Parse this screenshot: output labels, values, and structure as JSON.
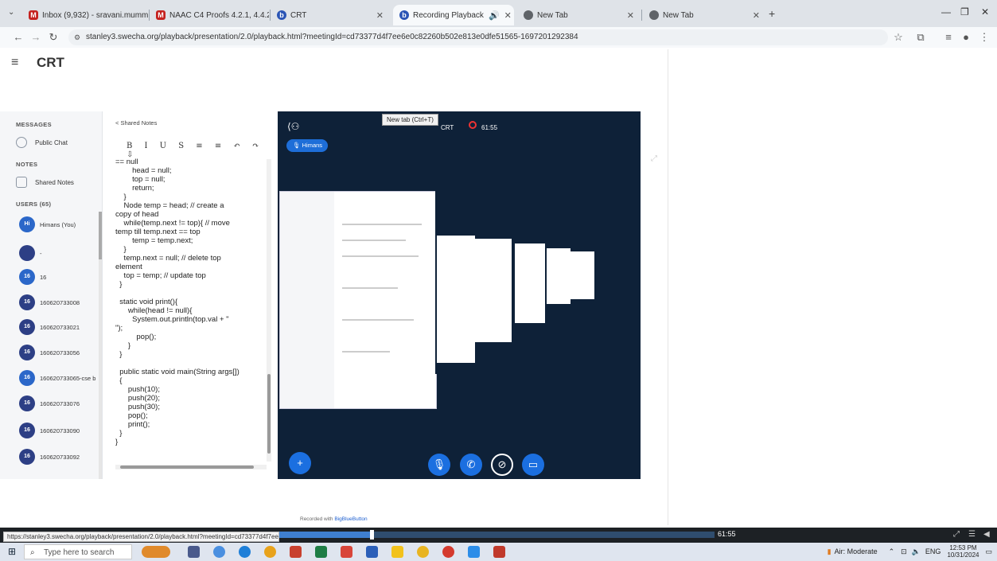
{
  "browser": {
    "tabs": [
      {
        "label": "Inbox (9,932) - sravani.mummo...",
        "icon": "gmail-icon",
        "color": "#c5221f"
      },
      {
        "label": "NAAC C4 Proofs 4.2.1, 4.4.2, 4.3...",
        "icon": "gmail-icon",
        "color": "#c5221f"
      },
      {
        "label": "CRT",
        "icon": "bbb-icon",
        "color": "#2b55b5"
      },
      {
        "label": "Recording Playback",
        "icon": "bbb-icon",
        "color": "#2b55b5"
      },
      {
        "label": "New Tab",
        "icon": "chrome-icon",
        "color": "#5f6368"
      },
      {
        "label": "New Tab",
        "icon": "chrome-icon",
        "color": "#5f6368"
      }
    ],
    "url": "stanley3.swecha.org/playback/presentation/2.0/playback.html?meetingId=cd73377d4f7ee6e0c82260b502e813e0dfe51565-1697201292384",
    "hover_url": "https://stanley3.swecha.org/playback/presentation/2.0/playback.html?meetingId=cd73377d4f7ee6e0c82260b502e81..."
  },
  "app": {
    "title": "CRT"
  },
  "tooltip": "New tab (Ctrl+T)",
  "sidebar": {
    "messages_heading": "MESSAGES",
    "public_chat": "Public Chat",
    "notes_heading": "NOTES",
    "shared_notes": "Shared Notes",
    "users_heading": "USERS (65)",
    "users": [
      {
        "initials": "Hi",
        "name": "Himans (You)"
      },
      {
        "initials": "",
        "name": "-"
      },
      {
        "initials": "16",
        "name": "16"
      },
      {
        "initials": "16",
        "name": "160620733008"
      },
      {
        "initials": "16",
        "name": "160620733021"
      },
      {
        "initials": "16",
        "name": "160620733056"
      },
      {
        "initials": "16",
        "name": "160620733065-cse b"
      },
      {
        "initials": "16",
        "name": "160620733076"
      },
      {
        "initials": "16",
        "name": "160620733090"
      },
      {
        "initials": "16",
        "name": "160620733092"
      }
    ]
  },
  "notes": {
    "header": "< Shared Notes",
    "toolbar": "B I U S ≡ ≡ ↶ ↷ ⇩",
    "code": "== null\n        head = null;\n        top = null;\n        return;\n    }\n    Node temp = head; // create a\ncopy of head\n    while(temp.next != top){ // move\ntemp till temp.next == top\n        temp = temp.next;\n    }\n    temp.next = null; // delete top\nelement\n    top = temp; // update top\n  }\n\n  static void print(){\n      while(head != null){\n        System.out.println(top.val + \"\n\");\n          pop();\n      }\n  }\n\n  public static void main(String args[])\n  {\n      push(10);\n      push(20);\n      push(30);\n      pop();\n      print();\n  }\n}"
  },
  "stage": {
    "user_badge": "Himans",
    "meeting": "CRT",
    "timer": "61:55"
  },
  "recorded_by": {
    "prefix": "Recorded with ",
    "brand": "BigBlueButton"
  },
  "playback": {
    "time": "61:55",
    "progress": 0.514
  },
  "taskbar": {
    "search_placeholder": "Type here to search",
    "air": "Air: Moderate",
    "lang": "ENG",
    "time": "12:53 PM",
    "date": "10/31/2024"
  }
}
